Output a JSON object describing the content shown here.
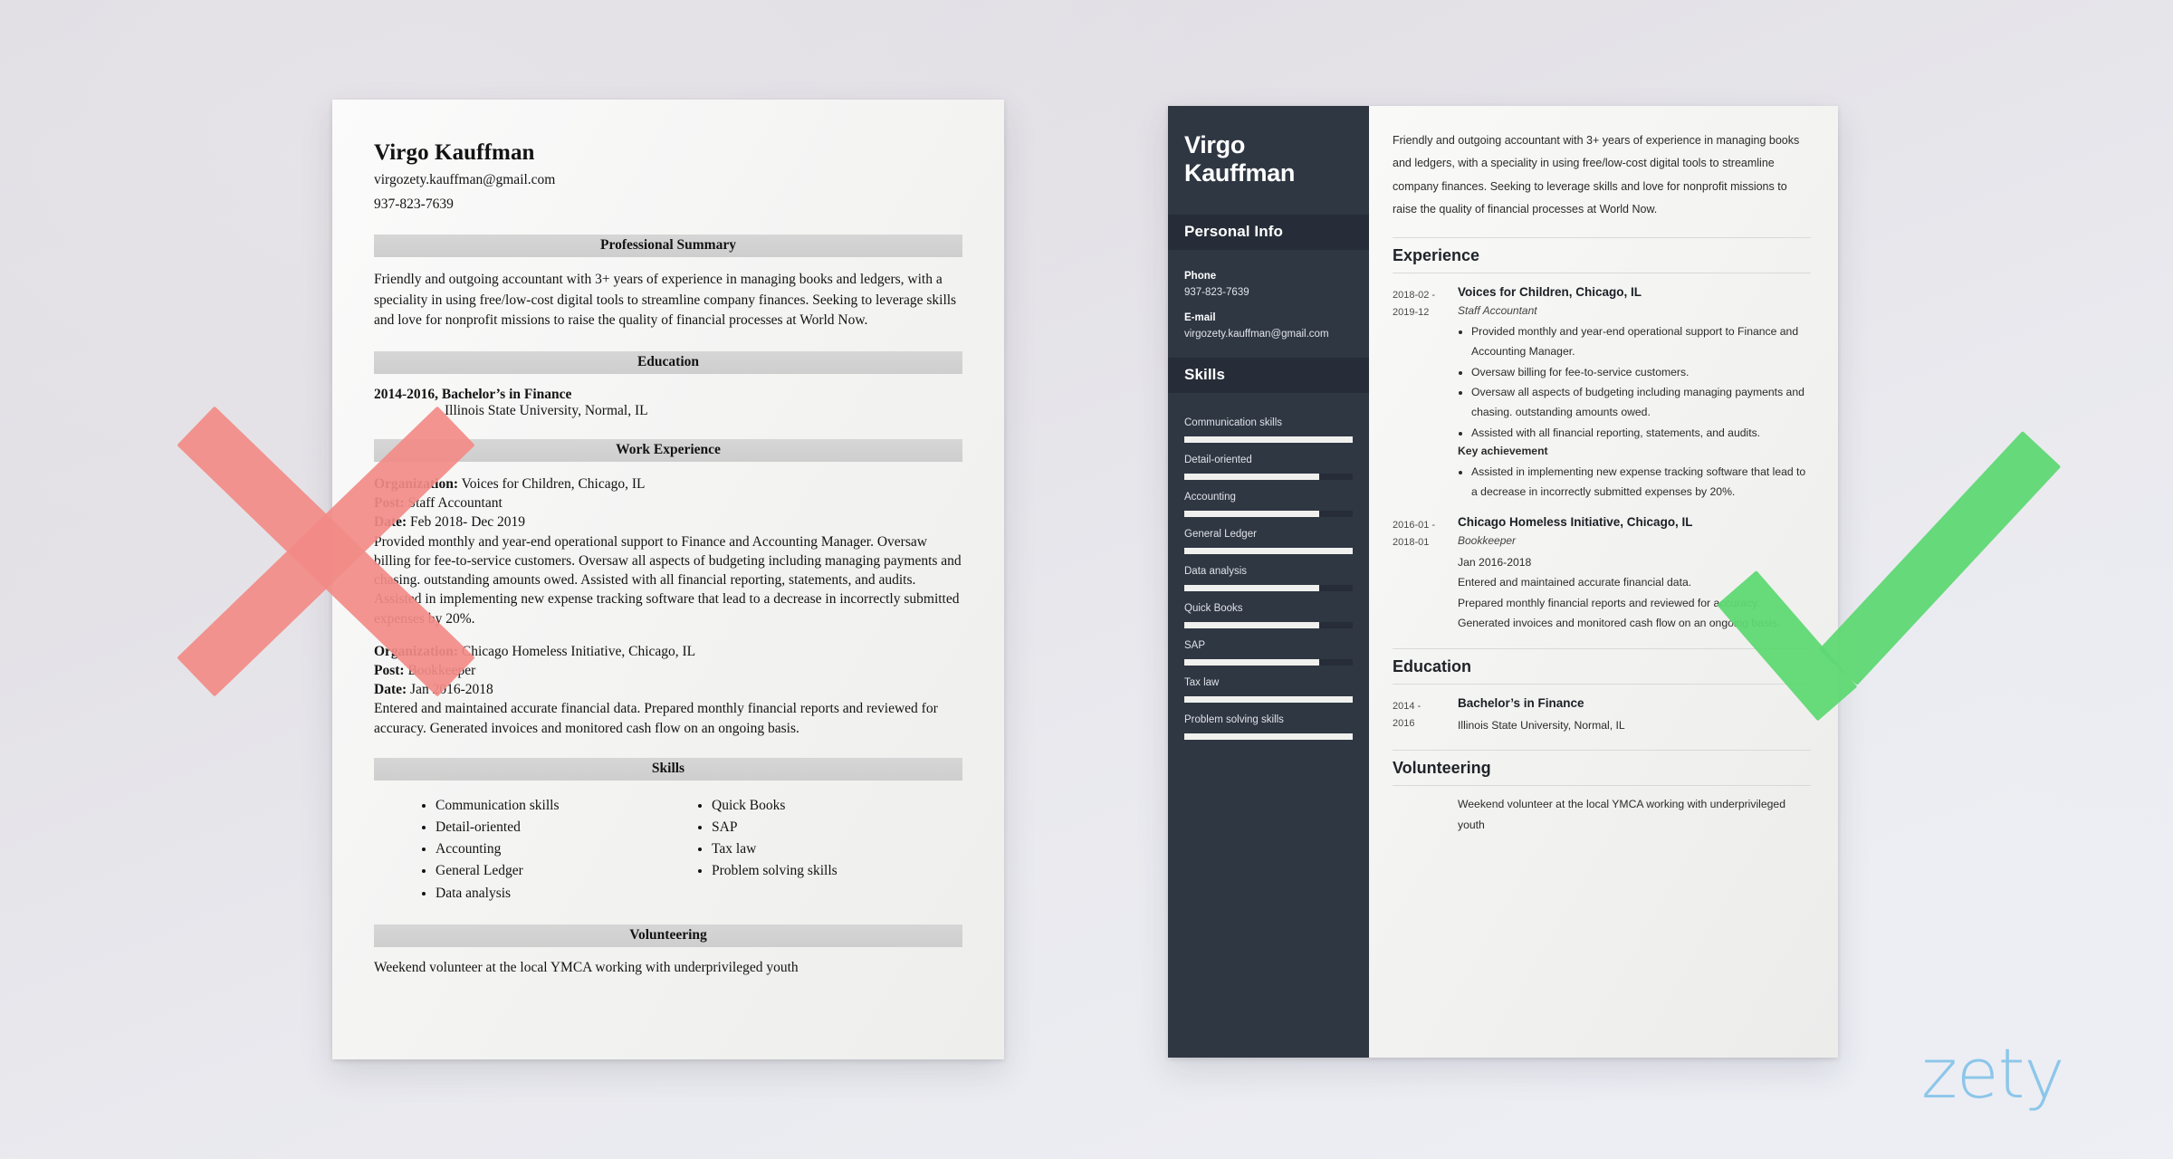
{
  "background": {
    "accent_red": "#F28B87",
    "accent_green": "#5FD873",
    "sidebar_dark": "#2F3743",
    "logo_blue": "#8CC6EA"
  },
  "branding": {
    "logo_text": "zety"
  },
  "marks": {
    "reject_icon": "x-mark-icon",
    "approve_icon": "check-mark-icon"
  },
  "bad_resume": {
    "name": "Virgo Kauffman",
    "email": "virgozety.kauffman@gmail.com",
    "phone": "937-823-7639",
    "sections": {
      "summary_heading": "Professional Summary",
      "summary_text": "Friendly and outgoing accountant with 3+ years of experience in managing books and ledgers, with a speciality in using free/low-cost digital tools to streamline company finances. Seeking to leverage skills and love for nonprofit missions to raise the quality of financial processes at World Now.",
      "education_heading": "Education",
      "education_line": "2014-2016, Bachelor’s in Finance",
      "education_school": "Illinois State University, Normal, IL",
      "work_heading": "Work Experience",
      "skills_heading": "Skills",
      "volunteering_heading": "Volunteering",
      "volunteering_text": "Weekend volunteer at the local YMCA working with underprivileged youth"
    },
    "labels": {
      "organization": "Organization:",
      "post": "Post:",
      "date": "Date:"
    },
    "jobs": [
      {
        "organization": "Voices for Children, Chicago, IL",
        "post": "Staff Accountant",
        "date": "Feb 2018- Dec 2019",
        "description": "Provided monthly and year-end operational support to Finance and Accounting Manager. Oversaw billing for fee-to-service customers. Oversaw all aspects of budgeting including managing payments and chasing. outstanding amounts owed. Assisted with all financial reporting, statements, and audits. Assisted in implementing new expense tracking software that lead to a decrease in incorrectly submitted expenses by 20%."
      },
      {
        "organization": "Chicago Homeless Initiative, Chicago, IL",
        "post": "Bookkeeper",
        "date": "Jan 2016-2018",
        "description": "Entered and maintained accurate financial data. Prepared monthly financial reports and reviewed for accuracy. Generated invoices and monitored cash flow on an ongoing basis."
      }
    ],
    "skills_col_1": [
      "Communication skills",
      "Detail-oriented",
      "Accounting",
      "General Ledger",
      "Data analysis"
    ],
    "skills_col_2": [
      "Quick Books",
      "SAP",
      "Tax law",
      "Problem solving skills"
    ]
  },
  "good_resume": {
    "sidebar": {
      "name_line1": "Virgo",
      "name_line2": "Kauffman",
      "personal_info_heading": "Personal Info",
      "phone_label": "Phone",
      "phone_value": "937-823-7639",
      "email_label": "E-mail",
      "email_value": "virgozety.kauffman@gmail.com",
      "skills_heading": "Skills",
      "skills": [
        {
          "name": "Communication skills",
          "level": 100
        },
        {
          "name": "Detail-oriented",
          "level": 80
        },
        {
          "name": "Accounting",
          "level": 80
        },
        {
          "name": "General Ledger",
          "level": 100
        },
        {
          "name": "Data analysis",
          "level": 80
        },
        {
          "name": "Quick Books",
          "level": 80
        },
        {
          "name": "SAP",
          "level": 80
        },
        {
          "name": "Tax law",
          "level": 100
        },
        {
          "name": "Problem solving skills",
          "level": 100
        }
      ]
    },
    "main": {
      "summary_text": "Friendly and outgoing accountant with 3+ years of experience in managing books and ledgers, with a speciality in using free/low-cost digital tools to streamline company finances. Seeking to leverage skills and love for nonprofit missions to raise the quality of financial processes at World Now.",
      "experience_heading": "Experience",
      "education_heading": "Education",
      "volunteering_heading": "Volunteering",
      "experience": [
        {
          "date_from": "2018-02 -",
          "date_to": "2019-12",
          "title": "Voices for Children, Chicago, IL",
          "role": "Staff Accountant",
          "bullets": [
            "Provided monthly and year-end operational support to Finance and Accounting Manager.",
            "Oversaw billing for fee-to-service customers.",
            "Oversaw all aspects of budgeting including managing payments and chasing. outstanding amounts owed.",
            "Assisted with all financial reporting, statements, and audits."
          ],
          "key_achievement_label": "Key achievement",
          "key_achievement_bullets": [
            "Assisted in implementing new expense tracking software that lead to a decrease in incorrectly submitted expenses by 20%."
          ]
        },
        {
          "date_from": "2016-01 -",
          "date_to": "2018-01",
          "title": "Chicago Homeless Initiative, Chicago, IL",
          "role": "Bookkeeper",
          "lines": [
            "Jan 2016-2018",
            "Entered and maintained accurate financial data.",
            "Prepared monthly financial reports and reviewed for accuracy.",
            "Generated invoices and monitored cash flow on an ongoing basis."
          ]
        }
      ],
      "education": [
        {
          "date_from": "2014 -",
          "date_to": "2016",
          "title": "Bachelor’s in Finance",
          "school": "Illinois State University, Normal, IL"
        }
      ],
      "volunteering_text": "Weekend volunteer at the local YMCA working with underprivileged youth"
    }
  }
}
